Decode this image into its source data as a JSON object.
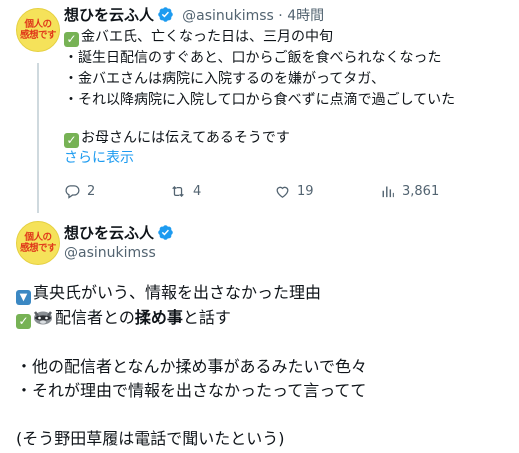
{
  "tweet1": {
    "avatar_text": [
      "個人の",
      "感想です"
    ],
    "name": "想ひを云ふ人",
    "handle_time": "@asinukimss · 4時間",
    "lines": [
      "金バエ氏、亡くなった日は、三月の中旬",
      "・誕生日配信のすぐあと、口からご飯を食べられなくなった",
      "・金バエさんは病院に入院するのを嫌がってタガ、",
      "・それ以降病院に入院して口から食べずに点滴で過ごしていた",
      "お母さんには伝えてあるそうです"
    ],
    "show_more": "さらに表示",
    "actions": {
      "reply_count": "2",
      "retweet_count": "4",
      "like_count": "19",
      "views_count": "3,861"
    }
  },
  "tweet2": {
    "avatar_text": [
      "個人の",
      "感想です"
    ],
    "name": "想ひを云ふ人",
    "handle": "@asinukimss",
    "line1": "真央氏がいう、情報を出さなかった理由",
    "line2_a": "配信者との",
    "line2_bold": "揉め事",
    "line2_b": "と話す",
    "line3": "・他の配信者となんか揉め事があるみたいで色々",
    "line4": "・それが理由で情報を出さなかったって言ってて",
    "line5": "(そう野田草履は電話で聞いたという)"
  },
  "colors": {
    "link": "#1d9bf0",
    "verified": "#1d9bf0",
    "check": "#77b255",
    "secondary_text": "#536471"
  }
}
